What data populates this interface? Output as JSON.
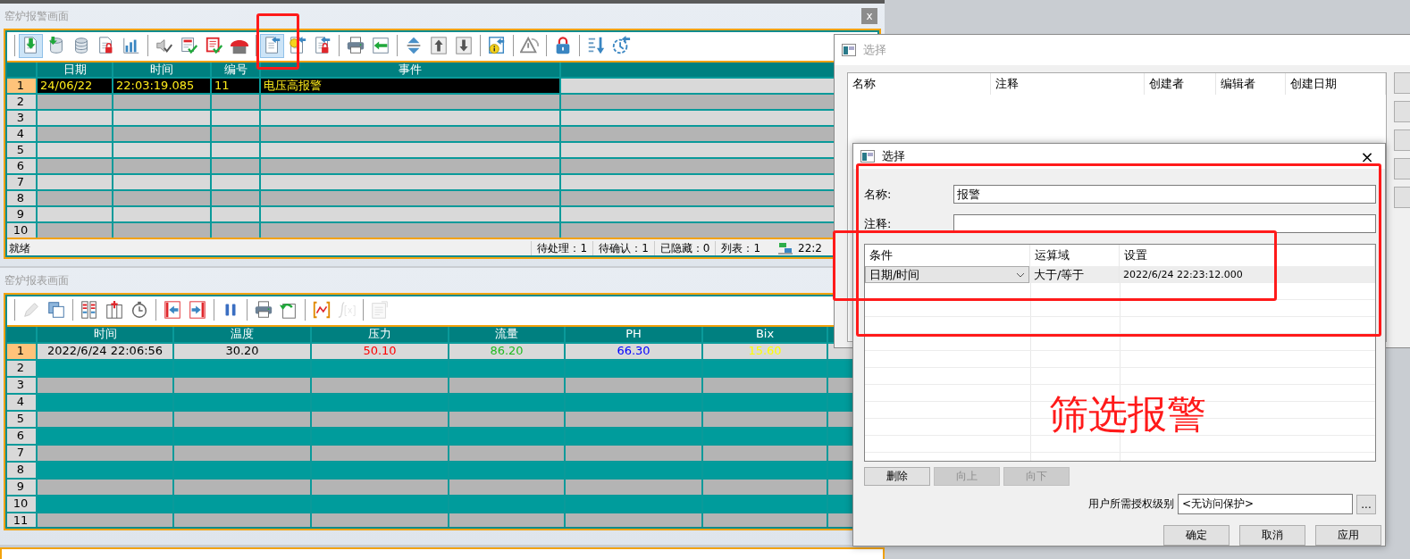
{
  "alarm_window": {
    "title": "窑炉报警画面",
    "close": "x",
    "toolbar": [
      {
        "pressed": true
      },
      {
        "pressed": false
      },
      {
        "pressed": false
      },
      {
        "pressed": false
      },
      {
        "pressed": false
      },
      {
        "pressed": false
      },
      {
        "pressed": false
      },
      {
        "pressed": false
      },
      {
        "pressed": false
      },
      {
        "pressed": true
      },
      {
        "pressed": false
      },
      {
        "pressed": false
      },
      {
        "pressed": false
      },
      {
        "pressed": false
      },
      {
        "pressed": false
      },
      {
        "pressed": false
      },
      {
        "pressed": false
      },
      {
        "pressed": false
      },
      {
        "pressed": false
      },
      {
        "pressed": false
      },
      {
        "pressed": false
      },
      {
        "pressed": false
      }
    ],
    "table": {
      "columns": [
        "日期",
        "时间",
        "编号",
        "事件"
      ],
      "rows": [
        {
          "number": "1",
          "selected": true,
          "cells": [
            "24/06/22",
            "22:03:19.085",
            "11",
            "电压高报警"
          ]
        },
        {
          "number": "2",
          "selected": false
        },
        {
          "number": "3",
          "selected": false
        },
        {
          "number": "4",
          "selected": false
        },
        {
          "number": "5",
          "selected": false
        },
        {
          "number": "6",
          "selected": false
        },
        {
          "number": "7",
          "selected": false
        },
        {
          "number": "8",
          "selected": false
        },
        {
          "number": "9",
          "selected": false
        },
        {
          "number": "10",
          "selected": false
        }
      ]
    },
    "status_bar": {
      "text": "就绪",
      "counters": [
        "待处理：1",
        "待确认：1",
        "已隐藏：0",
        "列表：1"
      ],
      "time": "22:2"
    }
  },
  "report_window": {
    "title": "窑炉报表画面",
    "toolbar": [
      {
        "disabled": true
      },
      {
        "disabled": false
      },
      {
        "disabled": false
      },
      {
        "disabled": false
      },
      {
        "disabled": false
      },
      {
        "disabled": false
      },
      {
        "disabled": false
      },
      {
        "disabled": false
      },
      {
        "disabled": false
      },
      {
        "disabled": false
      },
      {
        "disabled": false
      },
      {
        "disabled": true
      },
      {
        "disabled": true
      }
    ],
    "table": {
      "columns": [
        {
          "label": "时间",
          "color": "#000000"
        },
        {
          "label": "温度",
          "color": "#000000"
        },
        {
          "label": "压力",
          "color": "#ff0000"
        },
        {
          "label": "流量",
          "color": "#22bb22"
        },
        {
          "label": "PH",
          "color": "#0000ff"
        },
        {
          "label": "Bix",
          "color": "#ffff00"
        }
      ],
      "rows": [
        {
          "number": "1",
          "selected": true,
          "cells": [
            "2022/6/24 22:06:56",
            "30.20",
            "50.10",
            "86.20",
            "66.30",
            "15.60"
          ]
        },
        {
          "number": "2",
          "selected": false
        },
        {
          "number": "3",
          "selected": false
        },
        {
          "number": "4",
          "selected": false
        },
        {
          "number": "5",
          "selected": false
        },
        {
          "number": "6",
          "selected": false
        },
        {
          "number": "7",
          "selected": false
        },
        {
          "number": "8",
          "selected": false
        },
        {
          "number": "9",
          "selected": false
        },
        {
          "number": "10",
          "selected": false
        },
        {
          "number": "11",
          "selected": false
        }
      ]
    }
  },
  "back_dialog": {
    "title": "选择",
    "columns": [
      "名称",
      "注释",
      "创建者",
      "编辑者",
      "创建日期"
    ]
  },
  "front_dialog": {
    "title": "选择",
    "close": "×",
    "name_label": "名称:",
    "name_value": "报警",
    "comment_label": "注释:",
    "conditions": {
      "columns": [
        "条件",
        "运算域",
        "设置"
      ],
      "rows": [
        {
          "condition": "日期/时间",
          "operator": "大于/等于",
          "setting": "2022/6/24 22:23:12.000"
        }
      ]
    },
    "row_buttons": [
      {
        "label": "删除",
        "disabled": false
      },
      {
        "label": "向上",
        "disabled": true
      },
      {
        "label": "向下",
        "disabled": true
      }
    ],
    "auth_label": "用户所需授权级别",
    "auth_value": "<无访问保护>",
    "browse": "...",
    "buttons": [
      "确定",
      "取消",
      "应用"
    ]
  },
  "annotation": {
    "text": "筛选报警"
  }
}
